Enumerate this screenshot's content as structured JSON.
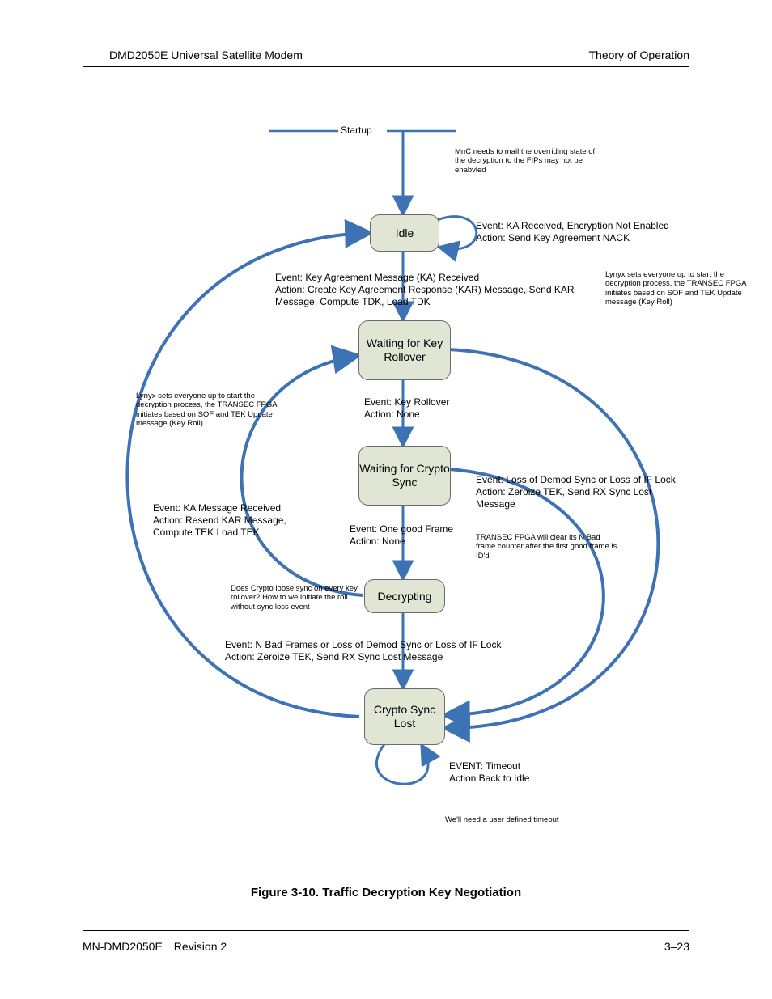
{
  "header": {
    "left": "DMD2050E Universal Satellite Modem",
    "right": "Theory of Operation"
  },
  "footer": {
    "left": "MN-DMD2050E Revision 2",
    "right": "3–23"
  },
  "caption": "Figure 3-10. Traffic Decryption Key Negotiation",
  "startup": "Startup",
  "states": {
    "idle": "Idle",
    "wait_key": "Waiting for Key Rollover",
    "wait_crypto": "Waiting for Crypto Sync",
    "decrypting": "Decrypting",
    "sync_lost": "Crypto Sync Lost"
  },
  "labels": {
    "idle_self": "Event: KA Received, Encryption Not Enabled\nAction: Send Key Agreement NACK",
    "idle_to_wait": "Event: Key Agreement Message (KA) Received\nAction: Create Key Agreement Response (KAR) Message, Send KAR Message, Compute TDK, Load TDK",
    "wait_to_crypto": "Event: Key Rollover\nAction: None",
    "crypto_to_decrypt": "Event: One good Frame\nAction: None",
    "decrypt_to_lost": "Event: N Bad Frames or Loss of Demod Sync or Loss of IF Lock\nAction: Zeroize TEK, Send RX Sync Lost Message",
    "crypto_to_lost": "Event: Loss of Demod Sync or Loss of IF Lock\nAction: Zeroize TEK, Send RX Sync Lost Message",
    "ka_received": "Event: KA Message Received\nAction: Resend KAR Message, Compute TEK Load TEK",
    "timeout": "EVENT: Timeout\nAction Back to Idle"
  },
  "notes": {
    "mnc": "MnC needs to mail the overriding state of the decryption to the FIPs may not be enabvled",
    "lynyx1": "Lynyx sets everyone up to start the decryption process, the TRANSEC FPGA initiates based on SOF and TEK Update message (Key Roll)",
    "lynyx2": "Lynyx sets everyone up to start the decryption process, the TRANSEC FPGA initiates based on SOF and TEK Update message (Key Roll)",
    "transec": "TRANSEC FPGA will clear its N Bad frame counter after the first good frame is ID'd",
    "crypto_q": "Does Crypto loose sync on every key rollover?  How to we initiate the roll without sync loss event",
    "user_timeout": "We'll need a user defined timeout"
  }
}
